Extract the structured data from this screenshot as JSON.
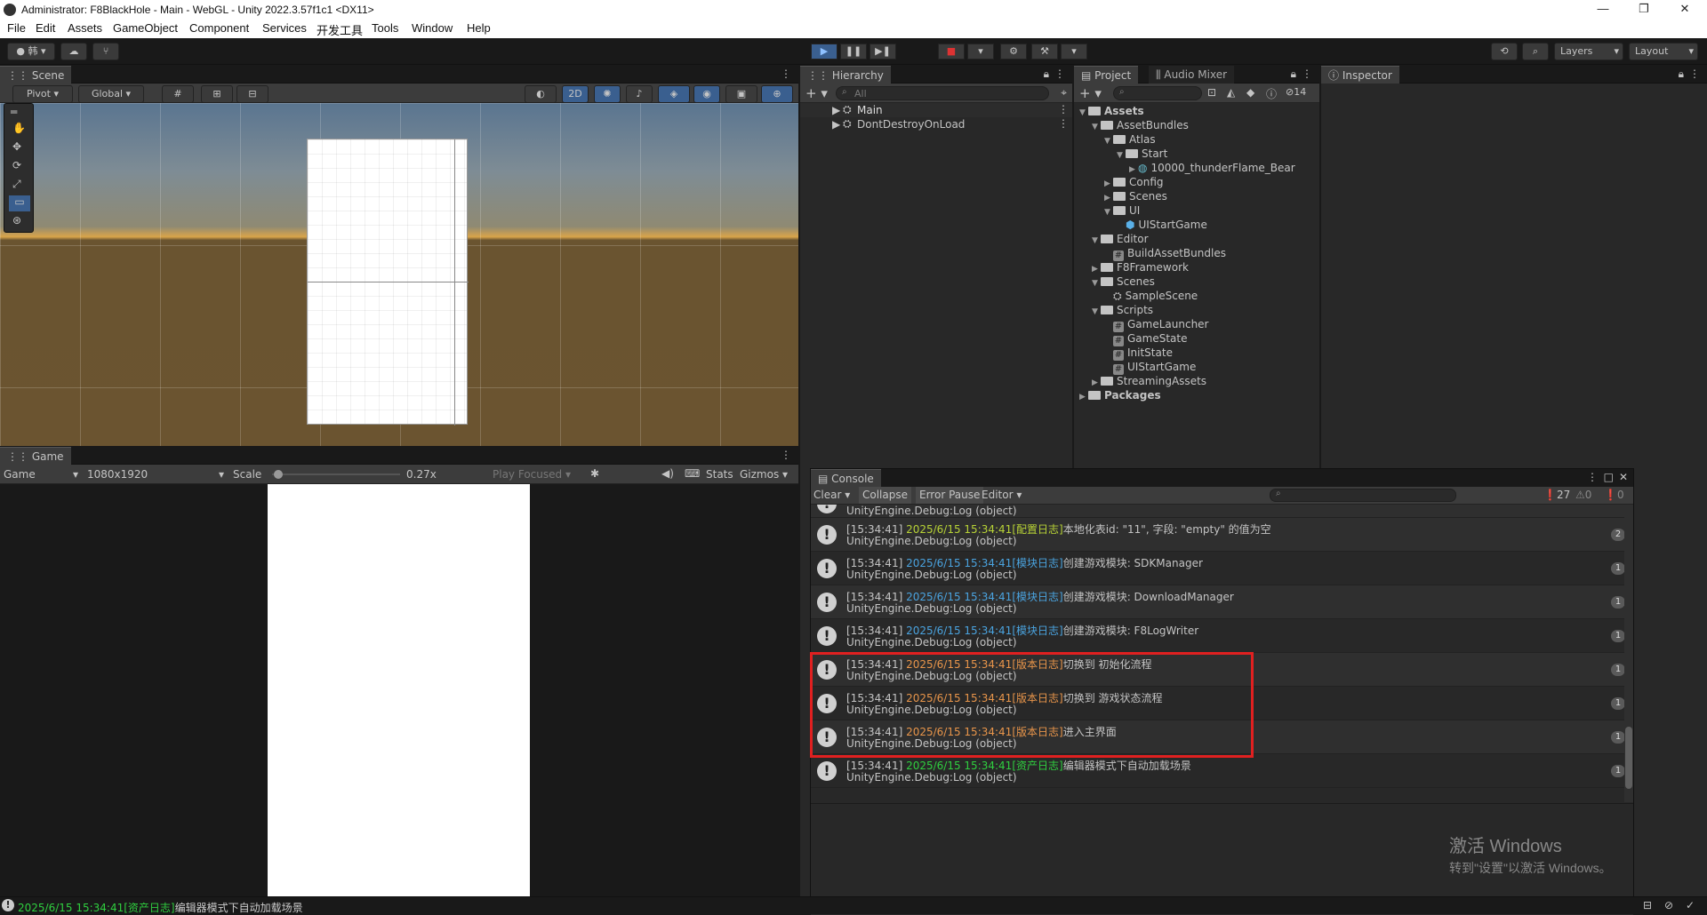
{
  "window": {
    "title": "Administrator: F8BlackHole - Main - WebGL - Unity 2022.3.57f1c1 <DX11>",
    "min": "—",
    "max": "❐",
    "close": "✕"
  },
  "menu": [
    "File",
    "Edit",
    "Assets",
    "GameObject",
    "Component",
    "Services",
    "开发工具",
    "Tools",
    "Window",
    "Help"
  ],
  "toolbar": {
    "account": "韩",
    "layers": "Layers",
    "layout": "Layout"
  },
  "scene": {
    "tab": "Scene",
    "pivot": "Pivot",
    "global": "Global",
    "mode2d": "2D"
  },
  "game": {
    "tab": "Game",
    "display": "Game",
    "resolution": "1080x1920",
    "scale_label": "Scale",
    "scale_value": "0.27x",
    "play_focused": "Play Focused",
    "stats": "Stats",
    "gizmos": "Gizmos"
  },
  "hierarchy": {
    "tab": "Hierarchy",
    "search_placeholder": "All",
    "items": [
      "Main",
      "DontDestroyOnLoad"
    ]
  },
  "project": {
    "tab": "Project",
    "tab2": "Audio Mixer",
    "count": "14",
    "tree": [
      {
        "label": "Assets",
        "bold": true
      },
      {
        "label": "AssetBundles"
      },
      {
        "label": "Atlas"
      },
      {
        "label": "Start"
      },
      {
        "label": "10000_thunderFlame_Bear"
      },
      {
        "label": "Config"
      },
      {
        "label": "Scenes"
      },
      {
        "label": "UI"
      },
      {
        "label": "UIStartGame"
      },
      {
        "label": "Editor"
      },
      {
        "label": "BuildAssetBundles"
      },
      {
        "label": "F8Framework"
      },
      {
        "label": "Scenes"
      },
      {
        "label": "SampleScene"
      },
      {
        "label": "Scripts"
      },
      {
        "label": "GameLauncher"
      },
      {
        "label": "GameState"
      },
      {
        "label": "InitState"
      },
      {
        "label": "UIStartGame"
      },
      {
        "label": "StreamingAssets"
      },
      {
        "label": "Packages",
        "bold": true
      }
    ]
  },
  "inspector": {
    "tab": "Inspector"
  },
  "console": {
    "tab": "Console",
    "clear": "Clear",
    "collapse": "Collapse",
    "error_pause": "Error Pause",
    "editor": "Editor",
    "log_count": "27",
    "warn_count": "0",
    "err_count": "0",
    "partial_row": "UnityEngine.Debug:Log (object)",
    "rows": [
      {
        "time": "[15:34:41] ",
        "stamp": "2025/6/15 15:34:41",
        "tag": "[配置日志]",
        "msg": "本地化表id: \"11\", 字段: \"empty\" 的值为空",
        "trace": "UnityEngine.Debug:Log (object)",
        "count": "2",
        "color": "#b8d336"
      },
      {
        "time": "[15:34:41] ",
        "stamp": "2025/6/15 15:34:41",
        "tag": "[模块日志]",
        "msg": "创建游戏模块: SDKManager",
        "trace": "UnityEngine.Debug:Log (object)",
        "count": "1",
        "color": "#4aa3df"
      },
      {
        "time": "[15:34:41] ",
        "stamp": "2025/6/15 15:34:41",
        "tag": "[模块日志]",
        "msg": "创建游戏模块: DownloadManager",
        "trace": "UnityEngine.Debug:Log (object)",
        "count": "1",
        "color": "#4aa3df"
      },
      {
        "time": "[15:34:41] ",
        "stamp": "2025/6/15 15:34:41",
        "tag": "[模块日志]",
        "msg": "创建游戏模块: F8LogWriter",
        "trace": "UnityEngine.Debug:Log (object)",
        "count": "1",
        "color": "#4aa3df"
      },
      {
        "time": "[15:34:41] ",
        "stamp": "2025/6/15 15:34:41",
        "tag": "[版本日志]",
        "msg": "切换到 初始化流程",
        "trace": "UnityEngine.Debug:Log (object)",
        "count": "1",
        "color": "#e8954a"
      },
      {
        "time": "[15:34:41] ",
        "stamp": "2025/6/15 15:34:41",
        "tag": "[版本日志]",
        "msg": "切换到 游戏状态流程",
        "trace": "UnityEngine.Debug:Log (object)",
        "count": "1",
        "color": "#e8954a"
      },
      {
        "time": "[15:34:41] ",
        "stamp": "2025/6/15 15:34:41",
        "tag": "[版本日志]",
        "msg": "进入主界面",
        "trace": "UnityEngine.Debug:Log (object)",
        "count": "1",
        "color": "#e8954a"
      },
      {
        "time": "[15:34:41] ",
        "stamp": "2025/6/15 15:34:41",
        "tag": "[资产日志]",
        "msg": "编辑器模式下自动加载场景",
        "trace": "UnityEngine.Debug:Log (object)",
        "count": "1",
        "color": "#2fcf3f"
      }
    ]
  },
  "watermark": {
    "line1": "激活 Windows",
    "line2": "转到\"设置\"以激活 Windows。"
  },
  "statusbar": {
    "stamp": "2025/6/15 15:34:41",
    "tag": "[资产日志]",
    "msg": "编辑器模式下自动加载场景"
  }
}
